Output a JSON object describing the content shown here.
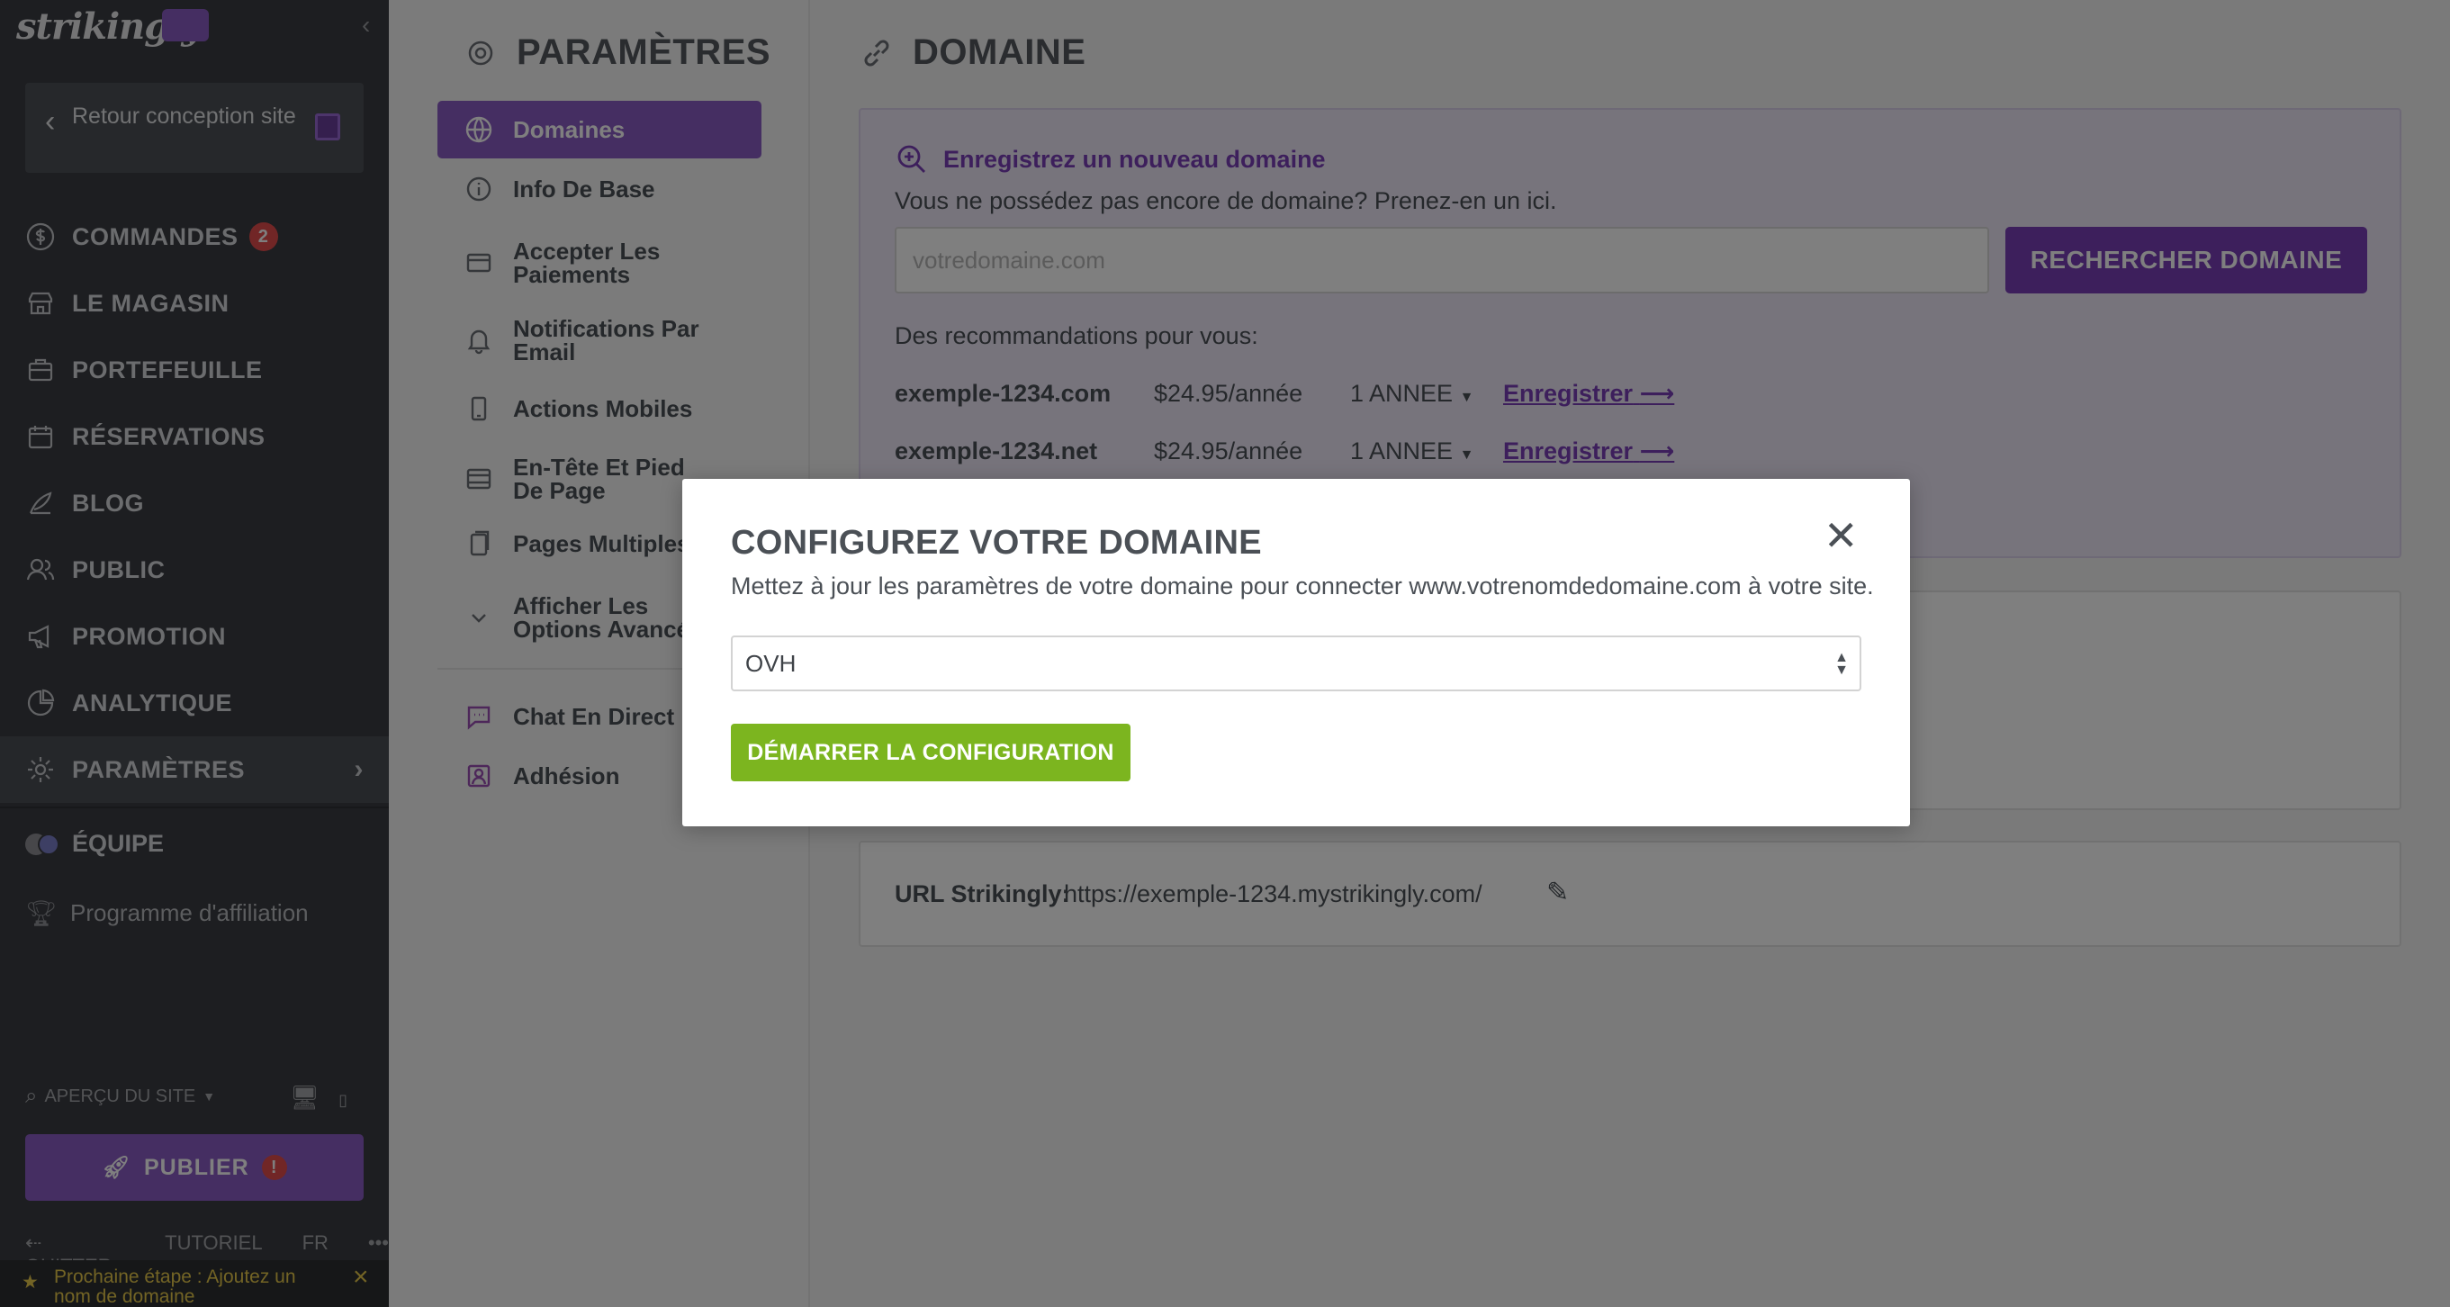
{
  "sidebar": {
    "logo": "strikingly",
    "back_label": "Retour conception site",
    "items": [
      {
        "label": "COMMANDES",
        "badge": "2",
        "icon": "dollar-icon"
      },
      {
        "label": "LE MAGASIN",
        "icon": "store-icon"
      },
      {
        "label": "PORTEFEUILLE",
        "icon": "briefcase-icon"
      },
      {
        "label": "RÉSERVATIONS",
        "icon": "calendar-icon"
      },
      {
        "label": "BLOG",
        "icon": "pen-icon"
      },
      {
        "label": "PUBLIC",
        "icon": "people-icon"
      },
      {
        "label": "PROMOTION",
        "icon": "megaphone-icon"
      },
      {
        "label": "ANALYTIQUE",
        "icon": "pie-chart-icon"
      },
      {
        "label": "PARAMÈTRES",
        "icon": "gear-icon",
        "active": true
      }
    ],
    "team_label": "ÉQUIPE",
    "affiliate_label": "Programme d'affiliation",
    "preview_label": "APERÇU DU SITE",
    "publish_label": "PUBLIER",
    "publish_alert": "!",
    "quit_label": "QUITTER",
    "tutorial_label": "TUTORIEL",
    "lang_label": "FR",
    "more_label": "•••",
    "next_step": "Prochaine étape : Ajoutez un nom de domaine"
  },
  "settings": {
    "title": "PARAMÈTRES",
    "menu": [
      {
        "label": "Domaines",
        "icon": "globe-icon",
        "active": true
      },
      {
        "label": "Info De Base",
        "icon": "info-icon"
      },
      {
        "label": "Accepter Les Paiements",
        "icon": "card-icon"
      },
      {
        "label": "Notifications Par Email",
        "icon": "bell-icon"
      },
      {
        "label": "Actions Mobiles",
        "icon": "mobile-icon"
      },
      {
        "label": "En-Tête Et Pied De Page",
        "icon": "layout-icon"
      },
      {
        "label": "Pages Multiples",
        "icon": "pages-icon"
      },
      {
        "label": "Afficher Les Options Avancées",
        "icon": "chevron-down-icon"
      }
    ],
    "extra": [
      {
        "label": "Chat En Direct",
        "icon": "chat-icon"
      },
      {
        "label": "Adhésion",
        "icon": "member-icon"
      }
    ]
  },
  "main": {
    "title": "DOMAINE",
    "register": {
      "heading": "Enregistrez un nouveau domaine",
      "subtitle": "Vous ne possédez pas encore de domaine? Prenez-en un ici.",
      "placeholder": "votredomaine.com",
      "search_button": "RECHERCHER DOMAINE",
      "rec_label": "Des recommandations pour vous:",
      "recommendations": [
        {
          "domain": "exemple-1234.com",
          "price": "$24.95/année",
          "years": "1 ANNEE",
          "action": "Enregistrer"
        },
        {
          "domain": "exemple-1234.net",
          "price": "$24.95/année",
          "years": "1 ANNEE",
          "action": "Enregistrer"
        }
      ]
    },
    "url_label": "URL Strikingly:",
    "url_value": "https://exemple-1234.mystrikingly.com/"
  },
  "modal": {
    "title": "CONFIGUREZ VOTRE DOMAINE",
    "description": "Mettez à jour les paramètres de votre domaine pour connecter www.votrenomdedomaine.com à votre site.",
    "selected_provider": "OVH",
    "start_button": "DÉMARRER LA CONFIGURATION",
    "close_glyph": "✕"
  },
  "colors": {
    "brand_purple": "#8b5cc4",
    "start_green": "#7cb51f",
    "sidebar_bg": "#3b3d42",
    "badge_red": "#e24d4d"
  }
}
